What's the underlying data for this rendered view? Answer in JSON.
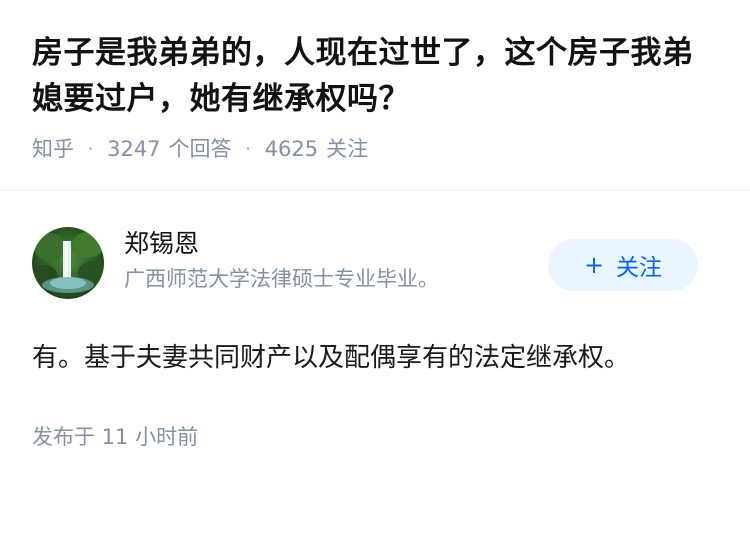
{
  "question": {
    "title": "房子是我弟弟的，人现在过世了，这个房子我弟媳要过户，她有继承权吗？",
    "source": "知乎",
    "answer_count": "3247",
    "answer_label": "个回答",
    "follow_count": "4625",
    "follow_label": "关注"
  },
  "answer": {
    "author_name": "郑锡恩",
    "author_bio": "广西师范大学法律硕士专业毕业。",
    "follow_button": "关注",
    "follow_icon": "plus-icon",
    "content": "有。基于夫妻共同财产以及配偶享有的法定继承权。",
    "published": "发布于  11 小时前"
  },
  "colors": {
    "meta_gray": "#8590a6",
    "accent": "#0066ff",
    "button_bg": "#ebf5ff"
  }
}
